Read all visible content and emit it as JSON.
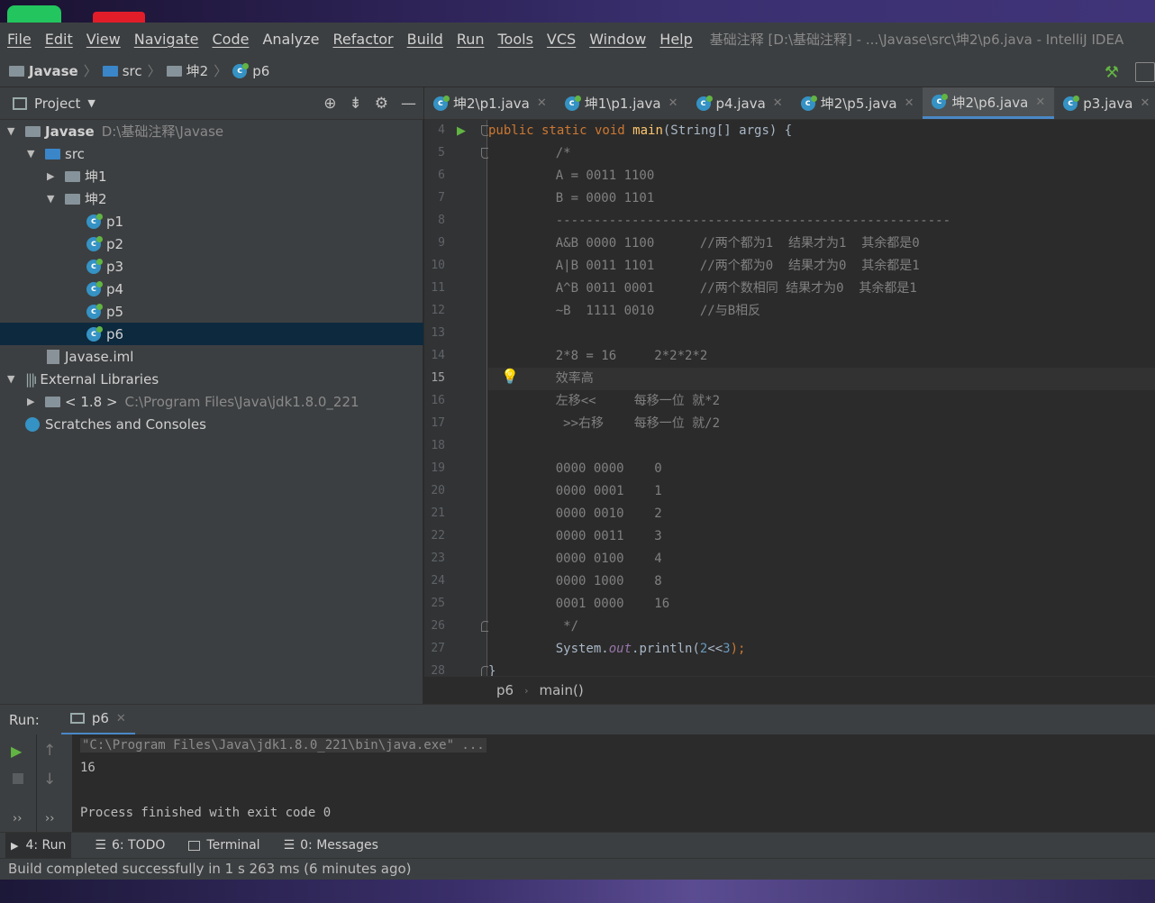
{
  "window_title": "基础注释 [D:\\基础注释] - ...\\Javase\\src\\坤2\\p6.java - IntelliJ IDEA",
  "menu": [
    "File",
    "Edit",
    "View",
    "Navigate",
    "Code",
    "Analyze",
    "Refactor",
    "Build",
    "Run",
    "Tools",
    "VCS",
    "Window",
    "Help"
  ],
  "nav": {
    "project": "Javase",
    "src": "src",
    "pkg": "坤2",
    "file": "p6"
  },
  "project_panel": {
    "title": "Project",
    "root_name": "Javase",
    "root_path": "D:\\基础注释\\Javase",
    "src": "src",
    "pkg1": "坤1",
    "pkg2": "坤2",
    "files": [
      "p1",
      "p2",
      "p3",
      "p4",
      "p5",
      "p6"
    ],
    "iml": "Javase.iml",
    "ext_libs": "External Libraries",
    "jdk_name": "< 1.8 >",
    "jdk_path": "C:\\Program Files\\Java\\jdk1.8.0_221",
    "scratches": "Scratches and Consoles"
  },
  "tabs": [
    "坤2\\p1.java",
    "坤1\\p1.java",
    "p4.java",
    "坤2\\p5.java",
    "坤2\\p6.java",
    "p3.java"
  ],
  "editor": {
    "line_numbers": [
      "4",
      "5",
      "6",
      "7",
      "8",
      "9",
      "10",
      "11",
      "12",
      "13",
      "14",
      "15",
      "16",
      "17",
      "18",
      "19",
      "20",
      "21",
      "22",
      "23",
      "24",
      "25",
      "26",
      "27",
      "28"
    ],
    "lines": [
      "    /*",
      "    A = 0011 1100",
      "    B = 0000 1101",
      "    ----------------------------------------------------",
      "    A&B 0000 1100      //两个都为1  结果才为1  其余都是0",
      "    A|B 0011 1101      //两个都为0  结果才为0  其余都是1",
      "    A^B 0011 0001      //两个数相同 结果才为0  其余都是1",
      "    ~B  1111 0010      //与B相反",
      "",
      "    2*8 = 16     2*2*2*2",
      "    效率高",
      "    左移<<     每移一位 就*2",
      "     >>右移    每移一位 就/2",
      "",
      "    0000 0000    0",
      "    0000 0001    1",
      "    0000 0010    2",
      "    0000 0011    3",
      "    0000 0100    4",
      "    0000 1000    8",
      "    0001 0000    16",
      "     */"
    ],
    "l4": {
      "kw": "public static void ",
      "fn": "main",
      "rest": "(String[] args) {"
    },
    "l27": {
      "a": "    System.",
      "b": "out",
      "c": ".println(",
      "d": "2",
      "e": "<<",
      "f": "3",
      "g": ");"
    },
    "l28": "}"
  },
  "breadcrumb": {
    "cls": "p6",
    "method": "main()"
  },
  "run": {
    "label": "Run:",
    "tab": "p6",
    "output": [
      "\"C:\\Program Files\\Java\\jdk1.8.0_221\\bin\\java.exe\" ...",
      "16",
      "",
      "Process finished with exit code 0"
    ]
  },
  "bottom_tabs": [
    "4: Run",
    "6: TODO",
    "Terminal",
    "0: Messages"
  ],
  "status": "Build completed successfully in 1 s 263 ms (6 minutes ago)"
}
